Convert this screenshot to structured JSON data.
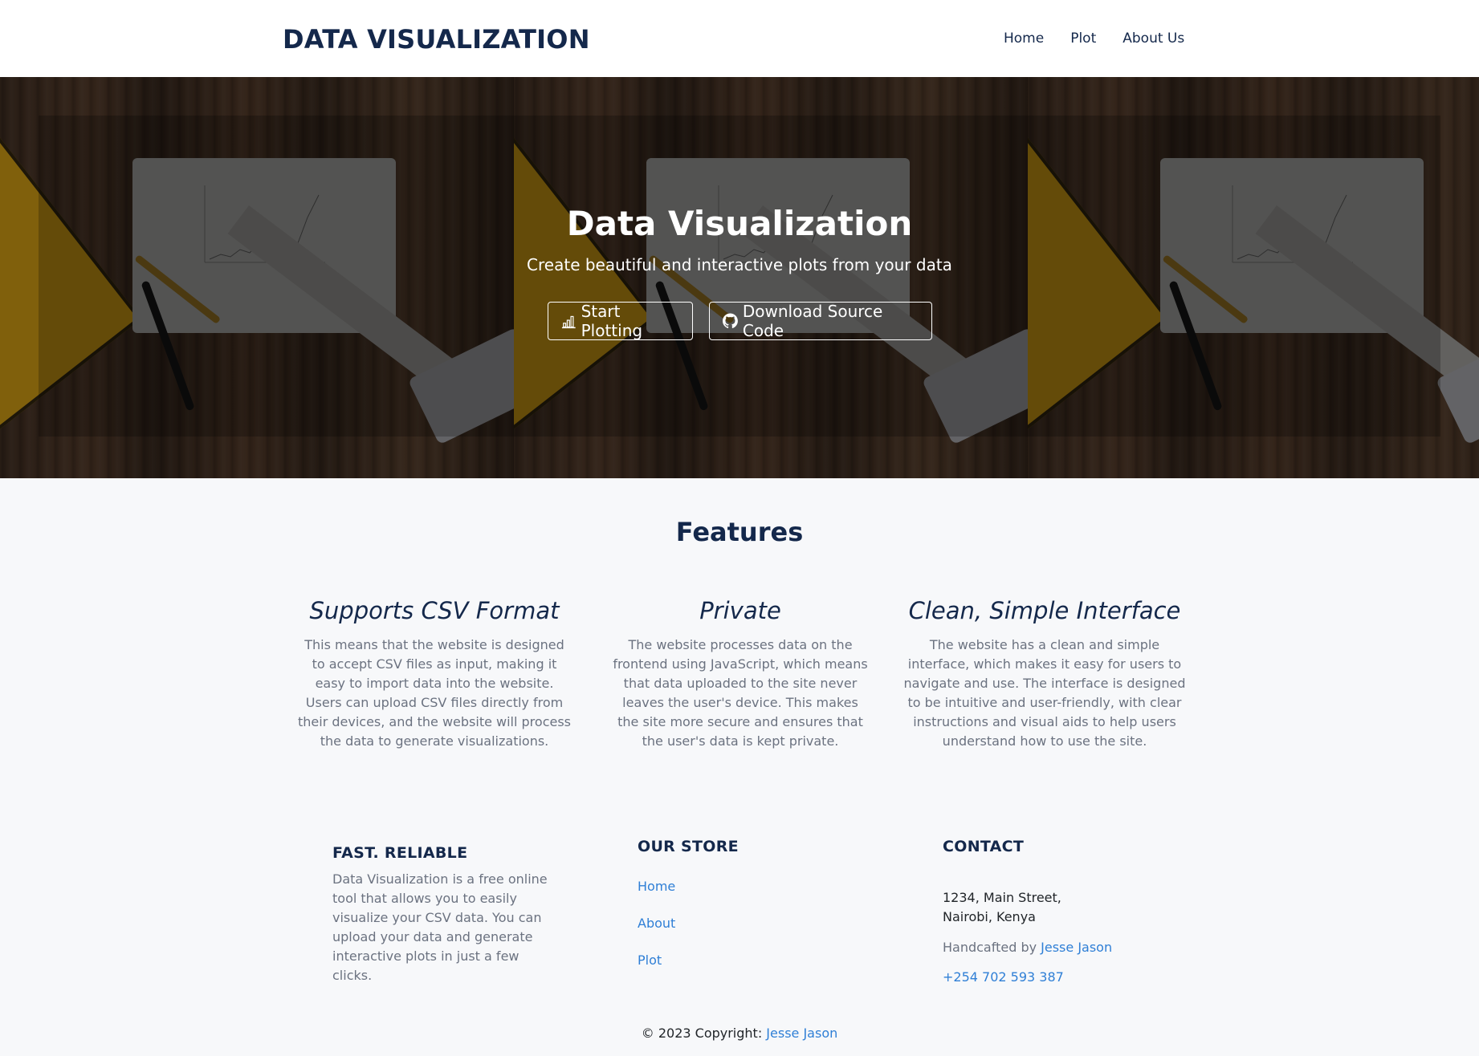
{
  "navbar": {
    "brand": "DATA VISUALIZATION",
    "links": [
      {
        "label": "Home"
      },
      {
        "label": "Plot"
      },
      {
        "label": "About Us"
      }
    ]
  },
  "hero": {
    "title": "Data Visualization",
    "subtitle": "Create beautiful and interactive plots from your data",
    "buttons": {
      "start": {
        "label": "Start Plotting",
        "icon": "bar-chart-icon"
      },
      "download": {
        "label": "Download Source Code",
        "icon": "github-icon"
      }
    }
  },
  "features": {
    "title": "Features",
    "items": [
      {
        "title": "Supports CSV Format",
        "text": "This means that the website is designed to accept CSV files as input, making it easy to import data into the website. Users can upload CSV files directly from their devices, and the website will process the data to generate visualizations."
      },
      {
        "title": "Private",
        "text": "The website processes data on the frontend using JavaScript, which means that data uploaded to the site never leaves the user's device. This makes the site more secure and ensures that the user's data is kept private."
      },
      {
        "title": "Clean, Simple Interface",
        "text": "The website has a clean and simple interface, which makes it easy for users to navigate and use. The interface is designed to be intuitive and user-friendly, with clear instructions and visual aids to help users understand how to use the site."
      }
    ]
  },
  "footer": {
    "about": {
      "heading": "FAST. RELIABLE",
      "text": "Data Visualization is a free online tool that allows you to easily visualize your CSV data. You can upload your data and generate interactive plots in just a few clicks."
    },
    "store": {
      "heading": "OUR STORE",
      "links": [
        "Home",
        "About",
        "Plot"
      ]
    },
    "contact": {
      "heading": "CONTACT",
      "address_line1": "1234, Main Street,",
      "address_line2": "Nairobi, Kenya",
      "credit_prefix": "Handcafted by ",
      "credit_name": "Jesse Jason",
      "phone": "+254 702 593 387"
    },
    "copyright_prefix": "© 2023 Copyright: ",
    "copyright_name": "Jesse Jason"
  },
  "colors": {
    "brand": "#14284b",
    "link": "#2f7fd6",
    "muted_text": "#6b7280",
    "background": "#f7f8fa"
  }
}
